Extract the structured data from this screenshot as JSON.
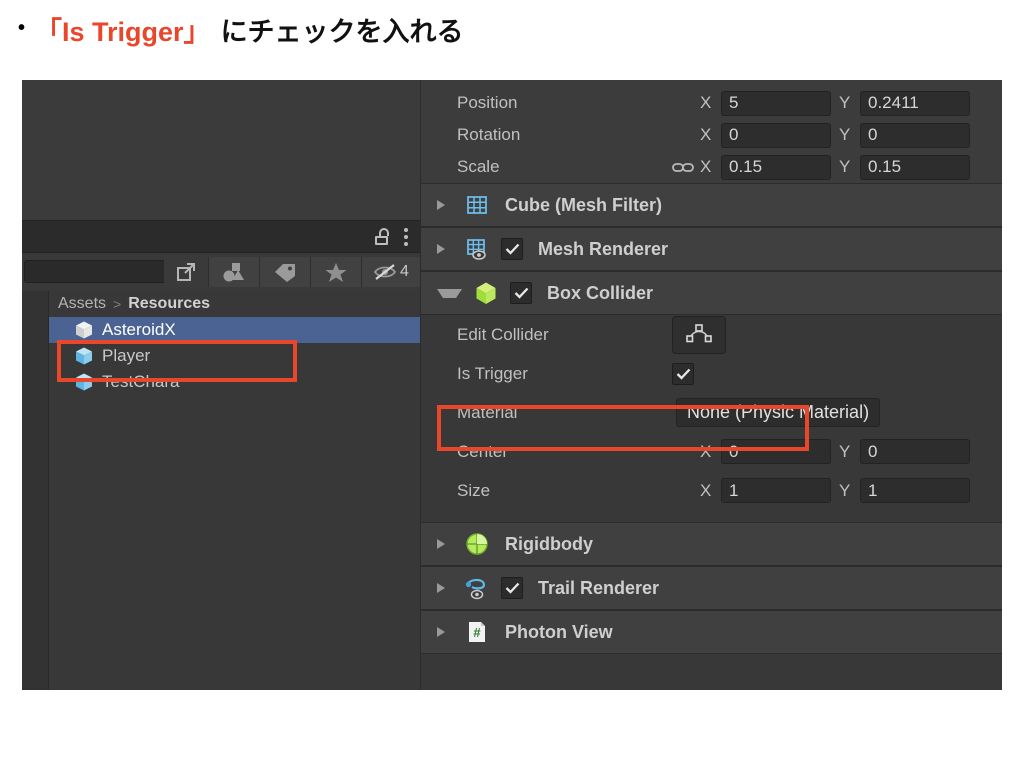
{
  "slide": {
    "bullet": "•",
    "heading_highlight": "「Is Trigger」",
    "heading_rest": "にチェックを入れる",
    "accent_color": "#e8472b"
  },
  "project_panel": {
    "lock_icon": "unlock-icon",
    "menu_icon": "kebab-menu-icon",
    "search_placeholder": "",
    "search_value": "",
    "toolbar_buttons": [
      {
        "name": "open-in-new-icon",
        "label": ""
      },
      {
        "name": "shapes-filter-icon",
        "label": ""
      },
      {
        "name": "tag-filter-icon",
        "label": ""
      },
      {
        "name": "favorites-star-icon",
        "label": ""
      },
      {
        "name": "hidden-eye-icon",
        "label": "4"
      }
    ],
    "breadcrumb": {
      "root": "Assets",
      "separator": ">",
      "current": "Resources"
    },
    "assets": [
      {
        "name": "AsteroidX",
        "icon": "prefab-cube-icon",
        "selected": true
      },
      {
        "name": "Player",
        "icon": "prefab-cube-icon",
        "selected": false
      },
      {
        "name": "TestChara",
        "icon": "prefab-cube-icon",
        "selected": false
      }
    ],
    "selection_color": "#4a6393"
  },
  "inspector": {
    "transform": [
      {
        "label": "Position",
        "linked": false,
        "x_axis": "X",
        "x": "5",
        "y_axis": "Y",
        "y": "0.2411"
      },
      {
        "label": "Rotation",
        "linked": false,
        "x_axis": "X",
        "x": "0",
        "y_axis": "Y",
        "y": "0"
      },
      {
        "label": "Scale",
        "linked": true,
        "x_axis": "X",
        "x": "0.15",
        "y_axis": "Y",
        "y": "0.15"
      }
    ],
    "components": [
      {
        "title": "Cube (Mesh Filter)",
        "icon": "mesh-filter-icon",
        "expanded": false,
        "has_checkbox": false,
        "checked": false
      },
      {
        "title": "Mesh Renderer",
        "icon": "mesh-renderer-icon",
        "expanded": false,
        "has_checkbox": true,
        "checked": true
      },
      {
        "title": "Box Collider",
        "icon": "box-collider-icon",
        "expanded": true,
        "has_checkbox": true,
        "checked": true
      }
    ],
    "box_collider": {
      "edit_collider_label": "Edit Collider",
      "edit_collider_icon": "edit-collider-polygon-icon",
      "is_trigger_label": "Is Trigger",
      "is_trigger_checked": true,
      "material_label": "Material",
      "material_value": "None (Physic Material)",
      "center_label": "Center",
      "center_x_axis": "X",
      "center_x": "0",
      "center_y_axis": "Y",
      "center_y": "0",
      "size_label": "Size",
      "size_x_axis": "X",
      "size_x": "1",
      "size_y_axis": "Y",
      "size_y": "1"
    },
    "components_bottom": [
      {
        "title": "Rigidbody",
        "icon": "rigidbody-icon",
        "expanded": false,
        "has_checkbox": false,
        "checked": false
      },
      {
        "title": "Trail Renderer",
        "icon": "trail-renderer-icon",
        "expanded": false,
        "has_checkbox": true,
        "checked": true
      },
      {
        "title": "Photon View",
        "icon": "script-hash-icon",
        "expanded": false,
        "has_checkbox": false,
        "checked": false
      }
    ]
  },
  "annotations": [
    {
      "name": "asteroidx-highlight",
      "color": "#e8472b"
    },
    {
      "name": "is-trigger-highlight",
      "color": "#e8472b"
    }
  ]
}
